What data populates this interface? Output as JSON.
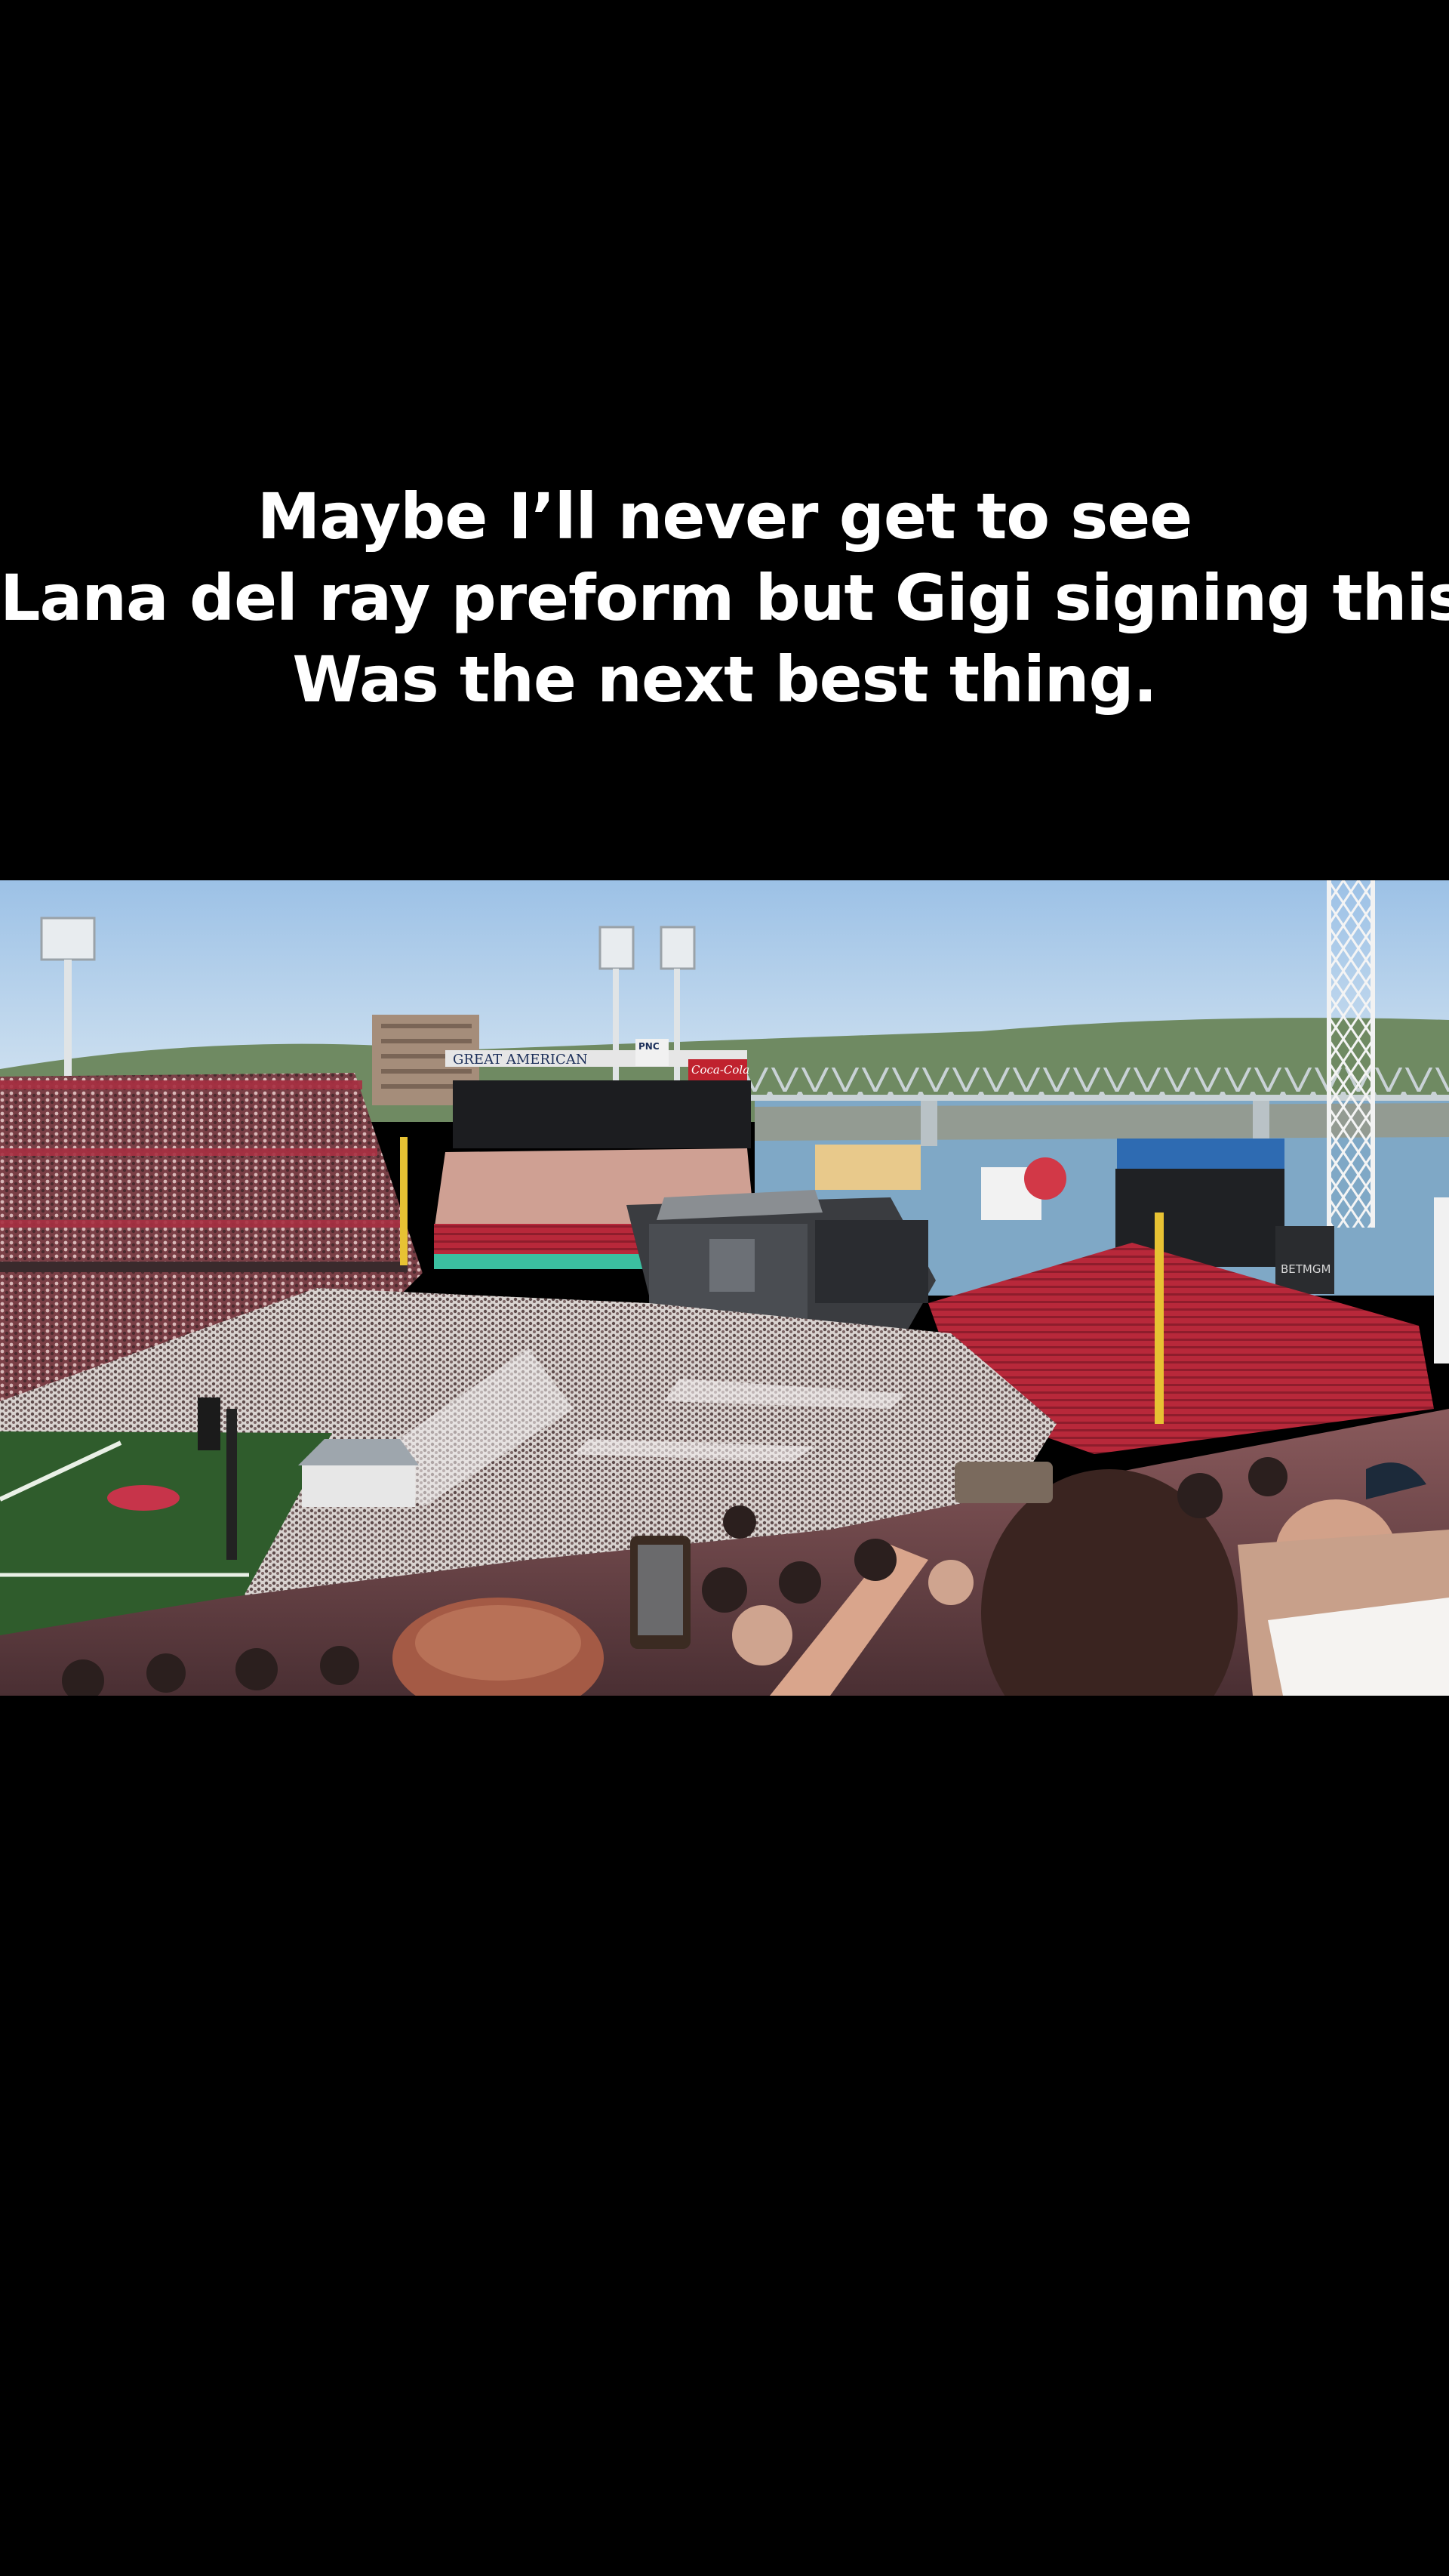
{
  "caption": {
    "line1": "Maybe I’ll never get to see",
    "line2": "Lana del ray preform but Gigi signing this",
    "line3": "Was the next best thing."
  },
  "photo": {
    "scoreboard_sign": "GREAT AMERICAN",
    "cola_sign": "Coca-Cola",
    "bank_sign": "PNC",
    "sportsbook_sign": "BETMGM"
  },
  "colors": {
    "background": "#000000",
    "caption_text": "#ffffff",
    "sky_top": "#9cc1e6",
    "sky_bottom": "#d4e4f1",
    "seats_red": "#b8283a",
    "field_green": "#2f5c2c",
    "river": "#7fa8c6"
  }
}
